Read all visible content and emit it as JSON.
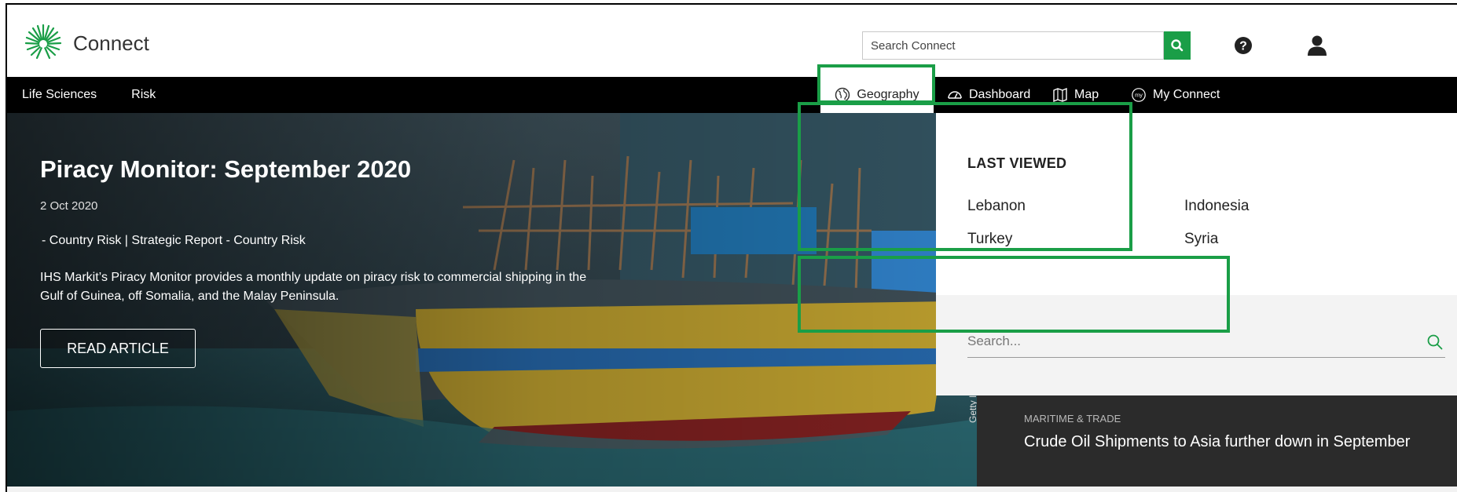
{
  "header": {
    "brand": "Connect",
    "search": {
      "placeholder": "Search Connect"
    }
  },
  "nav": {
    "left": [
      "Life Sciences",
      "Risk"
    ],
    "geography": "Geography",
    "dashboard": "Dashboard",
    "map": "Map",
    "my_connect": "My Connect"
  },
  "hero": {
    "title": "Piracy Monitor: September 2020",
    "date": "2 Oct 2020",
    "category": "- Country Risk | Strategic Report - Country Risk",
    "description": "IHS Markit’s Piracy Monitor provides a monthly update on piracy risk to commercial shipping in the Gulf of Guinea, off Somalia, and the Malay Peninsula.",
    "button": "READ ARTICLE",
    "credit": "Getty Images"
  },
  "geography_panel": {
    "title": "LAST VIEWED",
    "items": [
      "Lebanon",
      "Indonesia",
      "Turkey",
      "Syria"
    ],
    "search_placeholder": "Search..."
  },
  "side_story": {
    "category": "MARITIME & TRADE",
    "title": "Crude Oil Shipments to Asia further down in September"
  },
  "colors": {
    "accent": "#1a9e47",
    "navbar": "#000000",
    "side_story_bg": "#2b2b2b"
  },
  "icons": [
    "logo-icon",
    "search-icon",
    "help-icon",
    "user-icon",
    "globe-icon",
    "dashboard-icon",
    "map-icon",
    "my-connect-icon"
  ]
}
